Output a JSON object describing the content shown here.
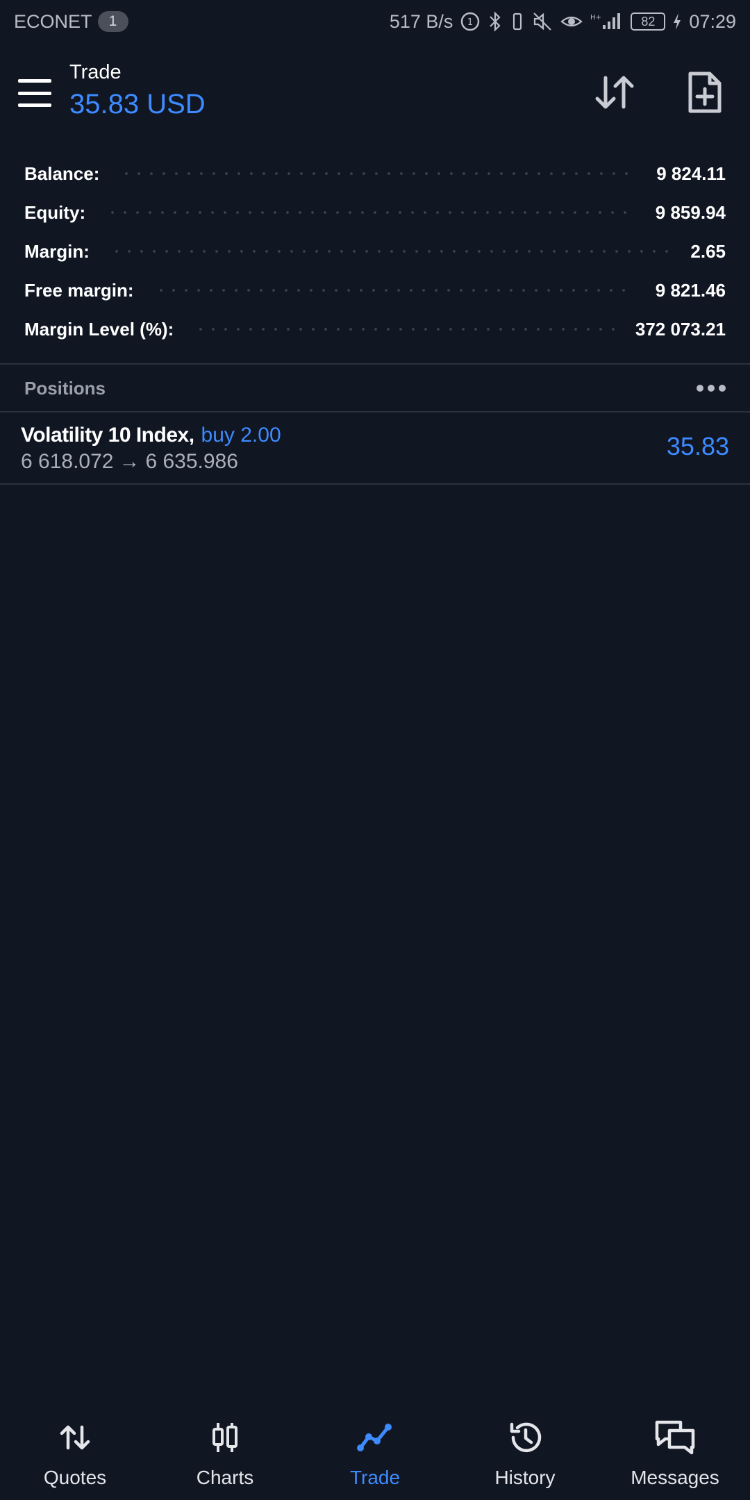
{
  "status_bar": {
    "carrier": "ECONET",
    "sim_badge": "1",
    "network_speed": "517 B/s",
    "battery": "82",
    "time": "07:29"
  },
  "header": {
    "title": "Trade",
    "amount": "35.83 USD",
    "icons": [
      "menu-icon",
      "sort-icon",
      "new-document-icon"
    ]
  },
  "summary": [
    {
      "label": "Balance:",
      "value": "9 824.11"
    },
    {
      "label": "Equity:",
      "value": "9 859.94"
    },
    {
      "label": "Margin:",
      "value": "2.65"
    },
    {
      "label": "Free margin:",
      "value": "9 821.46"
    },
    {
      "label": "Margin Level (%):",
      "value": "372 073.21"
    }
  ],
  "positions": {
    "title": "Positions",
    "items": [
      {
        "symbol": "Volatility 10 Index,",
        "type": "buy 2.00",
        "open_price": "6 618.072",
        "arrow": "→",
        "current_price": "6 635.986",
        "profit": "35.83"
      }
    ]
  },
  "bottom_nav": [
    {
      "label": "Quotes",
      "icon": "quotes-icon",
      "active": false
    },
    {
      "label": "Charts",
      "icon": "charts-icon",
      "active": false
    },
    {
      "label": "Trade",
      "icon": "trade-icon",
      "active": true
    },
    {
      "label": "History",
      "icon": "history-icon",
      "active": false
    },
    {
      "label": "Messages",
      "icon": "messages-icon",
      "active": false
    }
  ],
  "colors": {
    "background": "#111623",
    "accent": "#3d8bff",
    "text": "#ffffff",
    "muted": "#9aa0aa"
  }
}
